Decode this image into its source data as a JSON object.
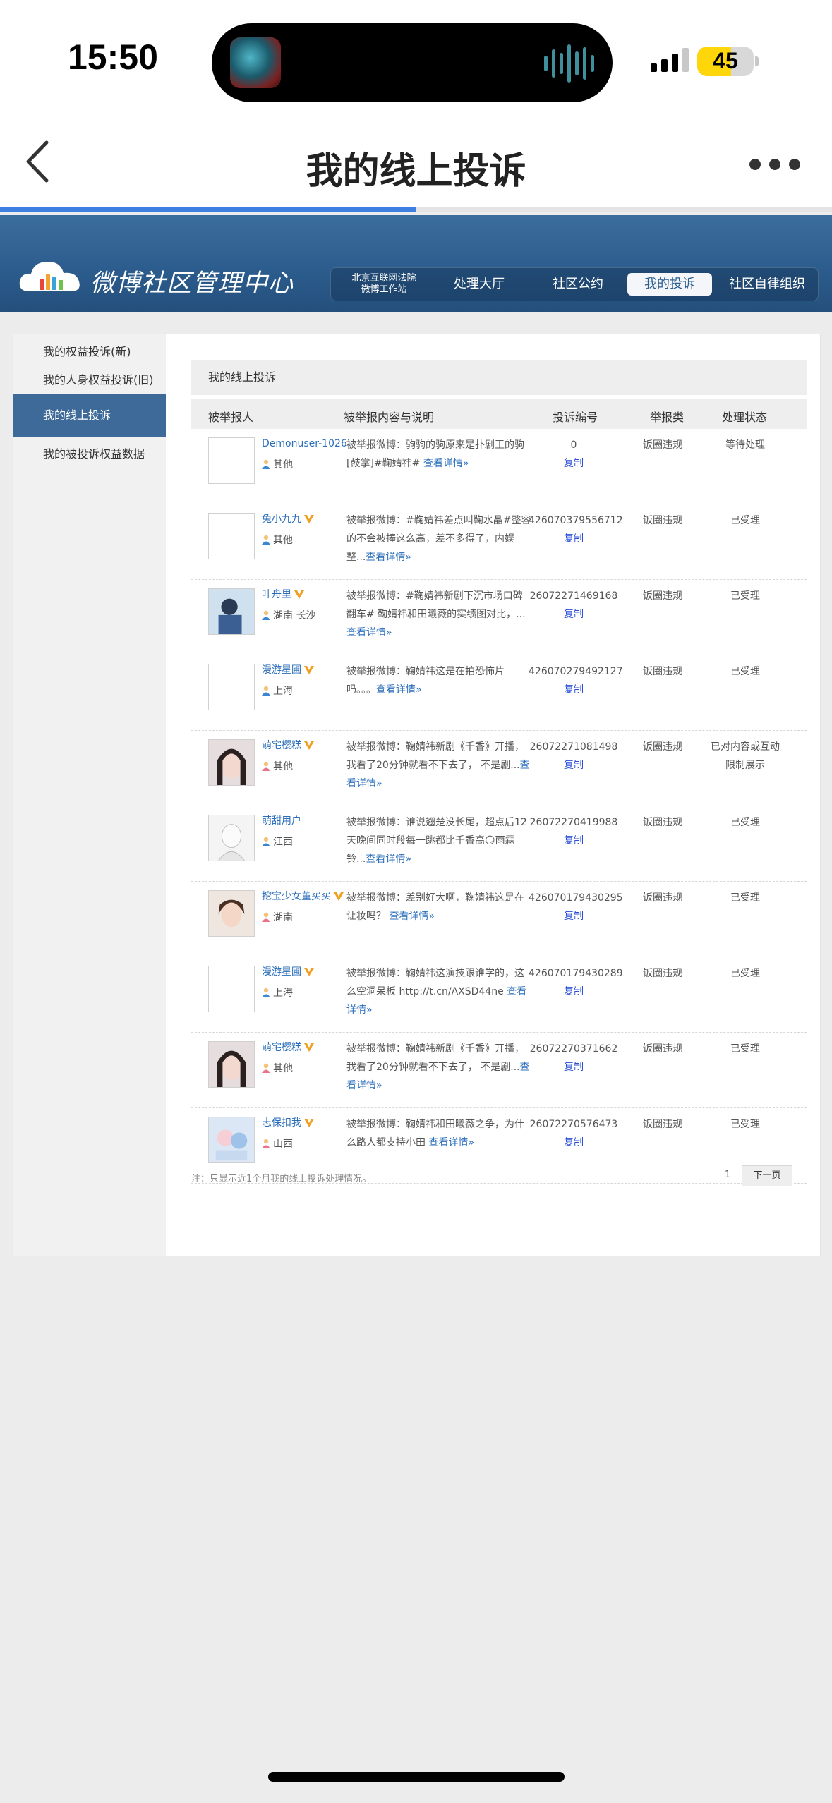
{
  "status_bar": {
    "time": "15:50",
    "battery": "45"
  },
  "nav": {
    "title": "我的线上投诉"
  },
  "browser": {
    "load_progress": 0.5
  },
  "banner": {
    "title": "微博社区管理中心",
    "badge_line1": "北京互联网法院",
    "badge_line2": "微博工作站",
    "menu": [
      "处理大厅",
      "社区公约",
      "我的投诉",
      "社区自律组织"
    ],
    "active_menu": "我的投诉"
  },
  "sidebar": {
    "items": [
      "我的权益投诉(新)",
      "我的人身权益投诉(旧)",
      "我的线上投诉",
      "我的被投诉权益数据"
    ],
    "active": "我的线上投诉"
  },
  "main": {
    "section_title": "我的线上投诉",
    "headers": [
      "被举报人",
      "被举报内容与说明",
      "投诉编号",
      "举报类",
      "处理状态"
    ],
    "copy_label": "复制",
    "more_label": "查看详情»",
    "footnote": "注：只显示近1个月我的线上投诉处理情况。",
    "page": "1",
    "next_label": "下一页"
  },
  "rows": [
    {
      "name": "Demonuser-1026",
      "verified": false,
      "location": "其他",
      "desc": "被举报微博：驹驹的驹原来是扑剧王的驹[鼓掌]#鞠婧祎# ",
      "more": "查看详情»",
      "id": "0",
      "type": "饭圈违规",
      "status": "等待处理",
      "avatar": "blank"
    },
    {
      "name": "兔小九九",
      "verified": true,
      "location": "其他",
      "desc": "被举报微博：#鞠婧祎差点叫鞠水晶#整容的不会被捧这么高，差不多得了，内娱整...",
      "more": "查看详情»",
      "id": "426070379556712",
      "type": "饭圈违规",
      "status": "已受理",
      "avatar": "blank"
    },
    {
      "name": "叶舟里",
      "verified": true,
      "location": "湖南 长沙",
      "desc": "被举报微博：#鞠婧祎新剧下沉市场口碑翻车# 鞠婧祎和田曦薇的实绩图对比，...",
      "more": "查看详情»",
      "id": "26072271469168",
      "type": "饭圈违规",
      "status": "已受理",
      "avatar": "photo-blue"
    },
    {
      "name": "漫游星圃",
      "verified": true,
      "location": "上海",
      "desc": "被举报微博：鞠婧祎这是在拍恐怖片吗。。。",
      "more": "查看详情»",
      "id": "426070279492127",
      "type": "饭圈违规",
      "status": "已受理",
      "avatar": "blank"
    },
    {
      "name": "萌宅樱糕",
      "verified": true,
      "location": "其他",
      "desc": "被举报微博：鞠婧祎新剧《千香》开播，我看了20分钟就看不下去了， 不是剧...",
      "more": "查看详情»",
      "id": "26072271081498",
      "type": "饭圈违规",
      "status": "已对内容或互动限制展示",
      "avatar": "photo-girl"
    },
    {
      "name": "萌甜用户",
      "verified": false,
      "location": "江西",
      "desc": "被举报微博：谁说翘楚没长尾，超点后12天晚间同时段每一跳都比千香高😏雨霖铃...",
      "more": "查看详情»",
      "id": "26072270419988",
      "type": "饭圈违规",
      "status": "已受理",
      "avatar": "photo-sketch"
    },
    {
      "name": "挖宝少女董买买",
      "verified": true,
      "location": "湖南",
      "desc": "被举报微博：差别好大啊，鞠婧祎这是在让妆吗？ ",
      "more": "查看详情»",
      "id": "426070179430295",
      "type": "饭圈违规",
      "status": "已受理",
      "avatar": "photo-face"
    },
    {
      "name": "漫游星圃",
      "verified": true,
      "location": "上海",
      "desc": "被举报微博：鞠婧祎这演技跟谁学的，这么空洞呆板 http://t.cn/AXSD44ne ",
      "more": "查看详情»",
      "id": "426070179430289",
      "type": "饭圈违规",
      "status": "已受理",
      "avatar": "blank"
    },
    {
      "name": "萌宅樱糕",
      "verified": true,
      "location": "其他",
      "desc": "被举报微博：鞠婧祎新剧《千香》开播，我看了20分钟就看不下去了， 不是剧...",
      "more": "查看详情»",
      "id": "26072270371662",
      "type": "饭圈违规",
      "status": "已受理",
      "avatar": "photo-girl"
    },
    {
      "name": "志保扣我",
      "verified": true,
      "location": "山西",
      "desc": "被举报微博：鞠婧祎和田曦薇之争，为什么路人都支持小田 ",
      "more": "查看详情»",
      "id": "26072270576473",
      "type": "饭圈违规",
      "status": "已受理",
      "avatar": "photo-anime"
    }
  ]
}
